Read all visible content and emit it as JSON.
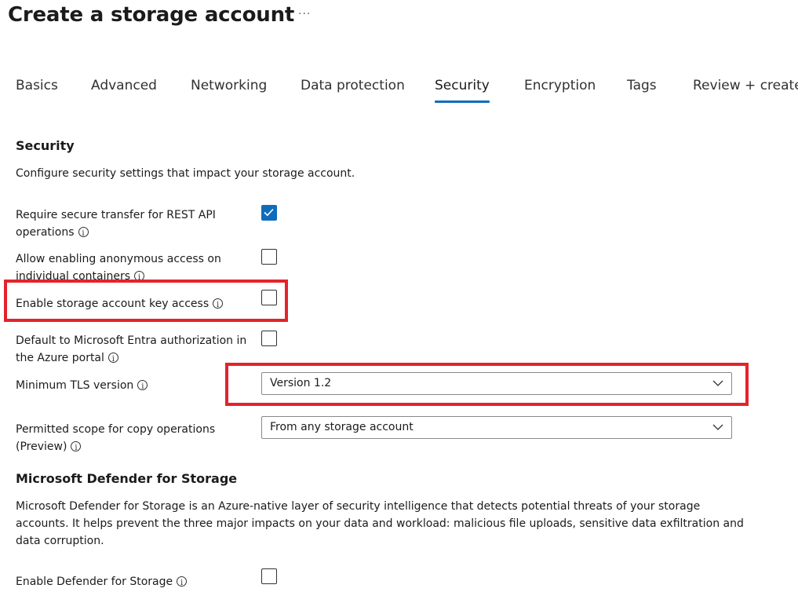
{
  "header": {
    "title": "Create a storage account",
    "more_label": "···"
  },
  "tabs": [
    {
      "label": "Basics",
      "active": false
    },
    {
      "label": "Advanced",
      "active": false
    },
    {
      "label": "Networking",
      "active": false
    },
    {
      "label": "Data protection",
      "active": false
    },
    {
      "label": "Security",
      "active": true
    },
    {
      "label": "Encryption",
      "active": false
    },
    {
      "label": "Tags",
      "active": false
    },
    {
      "label": "Review + create",
      "active": false
    }
  ],
  "security": {
    "heading": "Security",
    "description": "Configure security settings that impact your storage account.",
    "settings": [
      {
        "label": "Require secure transfer for REST API operations",
        "checked": true
      },
      {
        "label": "Allow enabling anonymous access on individual containers",
        "checked": false
      },
      {
        "label": "Enable storage account key access",
        "checked": false
      },
      {
        "label": "Default to Microsoft Entra authorization in the Azure portal",
        "checked": false
      }
    ],
    "tls": {
      "label": "Minimum TLS version",
      "value": "Version 1.2"
    },
    "copy_scope": {
      "label": "Permitted scope for copy operations (Preview)",
      "value": "From any storage account"
    }
  },
  "defender": {
    "heading": "Microsoft Defender for Storage",
    "description": "Microsoft Defender for Storage is an Azure-native layer of security intelligence that detects potential threats of your storage accounts. It helps prevent the three major impacts on your data and workload: malicious file uploads, sensitive data exfiltration and data corruption.",
    "enable_label": "Enable Defender for Storage",
    "enable_checked": false
  },
  "colors": {
    "accent": "#0f6cbd",
    "highlight": "#e3232b"
  }
}
